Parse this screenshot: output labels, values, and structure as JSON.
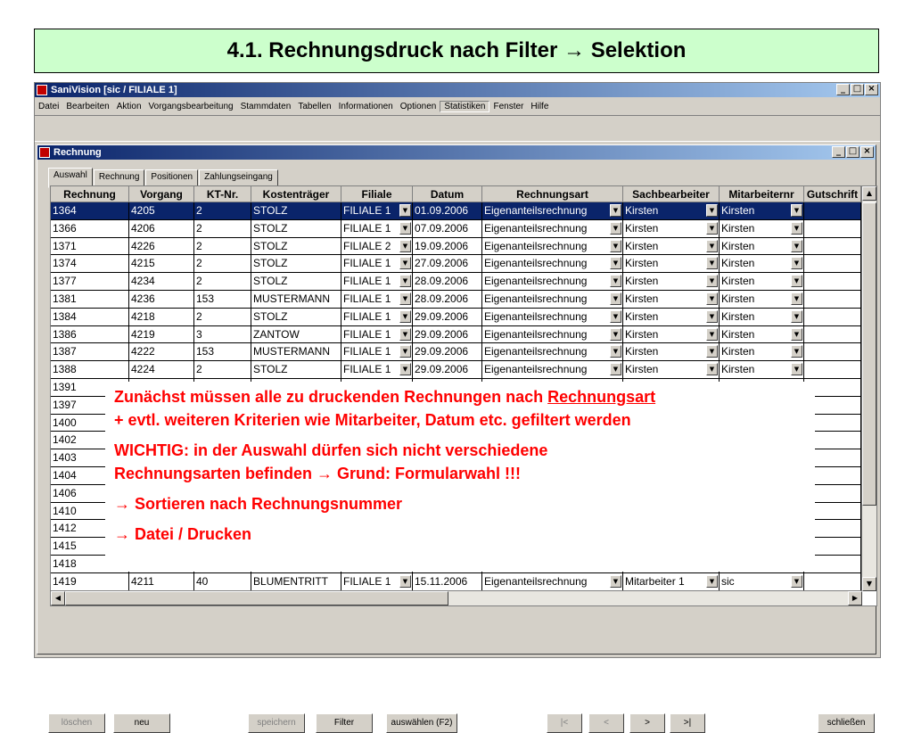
{
  "slide": {
    "title": "4.1. Rechnungsdruck nach Filter → Selektion"
  },
  "app": {
    "title": "SaniVision [sic / FILIALE 1]",
    "menu": [
      "Datei",
      "Bearbeiten",
      "Aktion",
      "Vorgangsbearbeitung",
      "Stammdaten",
      "Tabellen",
      "Informationen",
      "Optionen",
      "Statistiken",
      "Fenster",
      "Hilfe"
    ],
    "active_menu": "Statistiken",
    "win_buttons": {
      "min": "_",
      "max": "□",
      "close": "×"
    }
  },
  "child": {
    "title": "Rechnung",
    "tabs": [
      "Auswahl",
      "Rechnung",
      "Positionen",
      "Zahlungseingang"
    ],
    "active_tab": "Auswahl"
  },
  "grid": {
    "columns": [
      "Rechnung",
      "Vorgang",
      "KT-Nr.",
      "Kostenträger",
      "Filiale",
      "Datum",
      "Rechnungsart",
      "Sachbearbeiter",
      "Mitarbeiternr",
      "Gutschrift"
    ],
    "rows": [
      [
        "1364",
        "4205",
        "2",
        "STOLZ",
        "FILIALE 1",
        "01.09.2006",
        "Eigenanteilsrechnung",
        "Kirsten",
        "Kirsten",
        ""
      ],
      [
        "1366",
        "4206",
        "2",
        "STOLZ",
        "FILIALE 1",
        "07.09.2006",
        "Eigenanteilsrechnung",
        "Kirsten",
        "Kirsten",
        ""
      ],
      [
        "1371",
        "4226",
        "2",
        "STOLZ",
        "FILIALE 2",
        "19.09.2006",
        "Eigenanteilsrechnung",
        "Kirsten",
        "Kirsten",
        ""
      ],
      [
        "1374",
        "4215",
        "2",
        "STOLZ",
        "FILIALE 1",
        "27.09.2006",
        "Eigenanteilsrechnung",
        "Kirsten",
        "Kirsten",
        ""
      ],
      [
        "1377",
        "4234",
        "2",
        "STOLZ",
        "FILIALE 1",
        "28.09.2006",
        "Eigenanteilsrechnung",
        "Kirsten",
        "Kirsten",
        ""
      ],
      [
        "1381",
        "4236",
        "153",
        "MUSTERMANN",
        "FILIALE 1",
        "28.09.2006",
        "Eigenanteilsrechnung",
        "Kirsten",
        "Kirsten",
        ""
      ],
      [
        "1384",
        "4218",
        "2",
        "STOLZ",
        "FILIALE 1",
        "29.09.2006",
        "Eigenanteilsrechnung",
        "Kirsten",
        "Kirsten",
        ""
      ],
      [
        "1386",
        "4219",
        "3",
        "ZANTOW",
        "FILIALE 1",
        "29.09.2006",
        "Eigenanteilsrechnung",
        "Kirsten",
        "Kirsten",
        ""
      ],
      [
        "1387",
        "4222",
        "153",
        "MUSTERMANN",
        "FILIALE 1",
        "29.09.2006",
        "Eigenanteilsrechnung",
        "Kirsten",
        "Kirsten",
        ""
      ],
      [
        "1388",
        "4224",
        "2",
        "STOLZ",
        "FILIALE 1",
        "29.09.2006",
        "Eigenanteilsrechnung",
        "Kirsten",
        "Kirsten",
        ""
      ],
      [
        "1391",
        "",
        "",
        "",
        "",
        "",
        "",
        "",
        "",
        ""
      ],
      [
        "1397",
        "",
        "",
        "",
        "",
        "",
        "",
        "",
        "",
        ""
      ],
      [
        "1400",
        "",
        "",
        "",
        "",
        "",
        "",
        "",
        "",
        ""
      ],
      [
        "1402",
        "",
        "",
        "",
        "",
        "",
        "",
        "",
        "",
        ""
      ],
      [
        "1403",
        "",
        "",
        "",
        "",
        "",
        "",
        "",
        "",
        ""
      ],
      [
        "1404",
        "",
        "",
        "",
        "",
        "",
        "",
        "",
        "",
        ""
      ],
      [
        "1406",
        "",
        "",
        "",
        "",
        "",
        "",
        "",
        "",
        ""
      ],
      [
        "1410",
        "",
        "",
        "",
        "",
        "",
        "",
        "",
        "",
        ""
      ],
      [
        "1412",
        "",
        "",
        "",
        "",
        "",
        "",
        "",
        "",
        ""
      ],
      [
        "1415",
        "",
        "",
        "",
        "",
        "",
        "",
        "",
        "",
        ""
      ],
      [
        "1418",
        "",
        "",
        "",
        "",
        "",
        "",
        "",
        "",
        ""
      ],
      [
        "1419",
        "4211",
        "40",
        "BLUMENTRITT",
        "FILIALE 1",
        "15.11.2006",
        "Eigenanteilsrechnung",
        "Mitarbeiter 1",
        "sic",
        ""
      ]
    ],
    "selected_row": 0
  },
  "buttons": {
    "delete": "löschen",
    "new": "neu",
    "save": "speichern",
    "filter": "Filter",
    "select": "auswählen (F2)",
    "first": "|<",
    "prev": "<",
    "next": ">",
    "last": ">|",
    "close": "schließen"
  },
  "note": {
    "line1_prefix": "Zunächst müssen alle zu druckenden Rechnungen nach ",
    "line1_underlined": "Rechnungsart",
    "line2": "+ evtl. weiteren Kriterien wie Mitarbeiter, Datum etc. gefiltert werden",
    "line3": "WICHTIG: in der Auswahl dürfen sich nicht verschiedene",
    "line4": "Rechnungsarten befinden → Grund: Formularwahl !!!",
    "line5": "→ Sortieren nach Rechnungsnummer",
    "line6": "→ Datei / Drucken"
  }
}
